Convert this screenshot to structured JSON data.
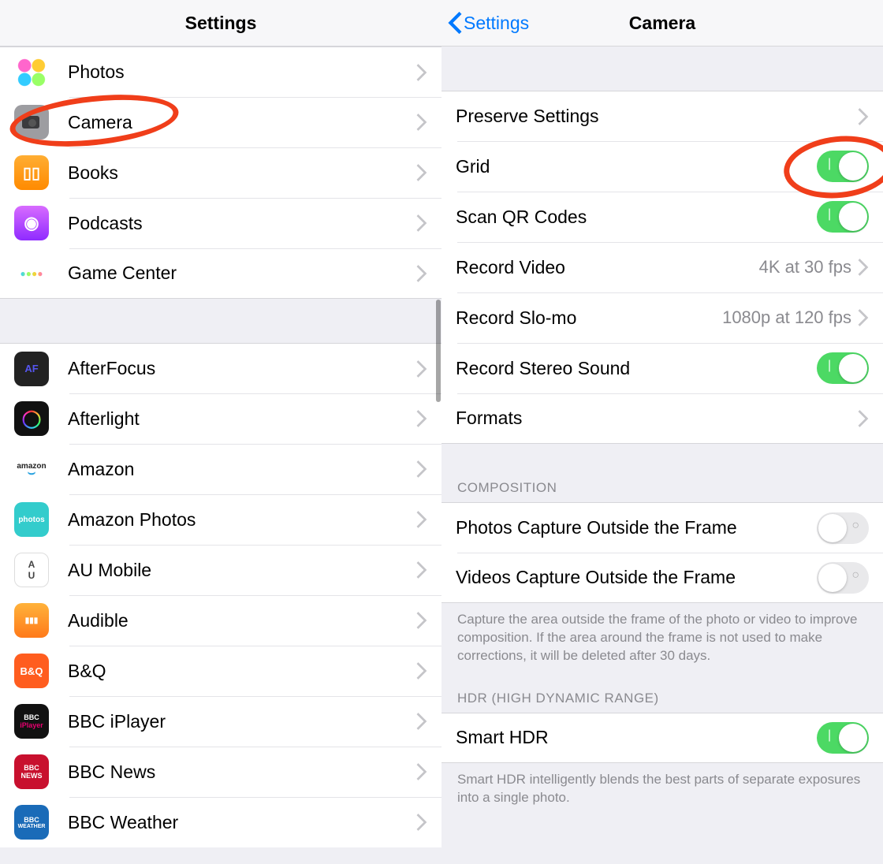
{
  "left": {
    "title": "Settings",
    "items_a": [
      {
        "label": "Photos",
        "icon": "ic-photos"
      },
      {
        "label": "Camera",
        "icon": "ic-camera"
      },
      {
        "label": "Books",
        "icon": "ic-books"
      },
      {
        "label": "Podcasts",
        "icon": "ic-pod"
      },
      {
        "label": "Game Center",
        "icon": "ic-gc"
      }
    ],
    "items_b": [
      {
        "label": "AfterFocus",
        "icon": "ic-af"
      },
      {
        "label": "Afterlight",
        "icon": "ic-al"
      },
      {
        "label": "Amazon",
        "icon": "ic-amz"
      },
      {
        "label": "Amazon Photos",
        "icon": "ic-amzp"
      },
      {
        "label": "AU Mobile",
        "icon": "ic-au"
      },
      {
        "label": "Audible",
        "icon": "ic-aud"
      },
      {
        "label": "B&Q",
        "icon": "ic-bq"
      },
      {
        "label": "BBC iPlayer",
        "icon": "ic-ip"
      },
      {
        "label": "BBC News",
        "icon": "ic-bn"
      },
      {
        "label": "BBC Weather",
        "icon": "ic-bw"
      }
    ]
  },
  "right": {
    "back": "Settings",
    "title": "Camera",
    "rows": {
      "preserve": "Preserve Settings",
      "grid": "Grid",
      "qr": "Scan QR Codes",
      "recvid": "Record Video",
      "recvid_val": "4K at 30 fps",
      "slomo": "Record Slo-mo",
      "slomo_val": "1080p at 120 fps",
      "stereo": "Record Stereo Sound",
      "formats": "Formats"
    },
    "comp_header": "Composition",
    "comp_photos": "Photos Capture Outside the Frame",
    "comp_videos": "Videos Capture Outside the Frame",
    "comp_footer": "Capture the area outside the frame of the photo or video to improve composition. If the area around the frame is not used to make corrections, it will be deleted after 30 days.",
    "hdr_header": "HDR (High Dynamic Range)",
    "hdr_row": "Smart HDR",
    "hdr_footer": "Smart HDR intelligently blends the best parts of separate exposures into a single photo."
  }
}
